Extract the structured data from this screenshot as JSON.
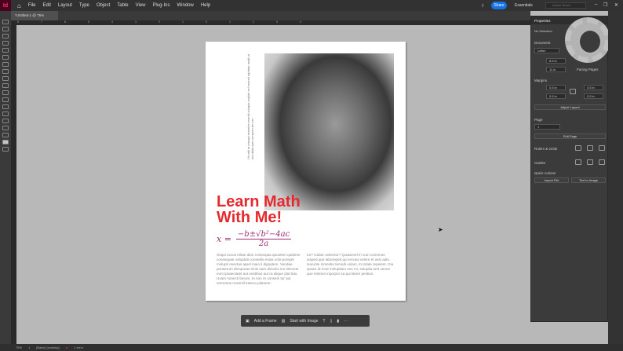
{
  "app": {
    "logo": "Id",
    "menus": [
      "File",
      "Edit",
      "Layout",
      "Type",
      "Object",
      "Table",
      "View",
      "Plug-Ins",
      "Window",
      "Help"
    ],
    "share": "Share",
    "workspace": "Essentials",
    "search_placeholder": "Adobe Stock"
  },
  "doc_tab": "*Untitled-1 @ 75%",
  "ruler_ticks": [
    "8",
    "7",
    "6",
    "5",
    "4",
    "3",
    "2",
    "1",
    "0",
    "1",
    "2",
    "3",
    "4"
  ],
  "page": {
    "title": "Learn Math With Me!",
    "formula": {
      "lhs": "x =",
      "numerator": "−b±√b²−4ac",
      "denominator": "2a"
    },
    "vertical_text": "Ut ratit at remqui venimbe eveniti volupta explab vel eraesti ruptatur audit ut aut ditiat que comped ute con",
    "col1": "Sequi occus reliae dion consequia quuntem quidene consequae voluptati consedis enias volo-porepis molupti onectas aped maio il dignatem. Vendae poriaerum demporae sinis sam dicianis mo inlecest eum ipsaectatet aut eostibus aut ra alique plat lato. Uxam nonecti berum, to non re conseni tor aut verruntus maximil itateca platume-",
    "col2": "tur? Icabor ovitectur? Quiasevel in cum conemos iasped que laboreped qui recusa velore et assi adio. Harunte nlorestio temodi volam, to totate repelent. Gia quaes id mod moluptiam eos mi, soluptia turit verum que entione inporpor sa qui istore pestius."
  },
  "panel": {
    "tabs": [
      "Properties"
    ],
    "selection": "No Selection",
    "document_label": "Document",
    "preset": "Letter",
    "width": "8.5 in",
    "height": "11 in",
    "facing": "Facing Pages",
    "margins_label": "Margins",
    "margin_top": "0.5 in",
    "margin_bottom": "0.5 in",
    "margin_left": "0.5 in",
    "margin_right": "0.5 in",
    "adjust_layout": "Adjust Layout",
    "page_label": "Page",
    "page_value": "1",
    "edit_page": "Edit Page",
    "rulers_grids": "Rulers & Grids",
    "guides": "Guides",
    "quick_actions": "Quick Actions",
    "import_file": "Import File",
    "text_to_image": "Text to Image"
  },
  "ctxbar": {
    "add_frame": "Add a Frame",
    "start_image": "Start with Image",
    "more": "···"
  },
  "status": {
    "zoom": "75%",
    "page": "1",
    "master": "[Basic] (working)",
    "errors": "1 error"
  }
}
